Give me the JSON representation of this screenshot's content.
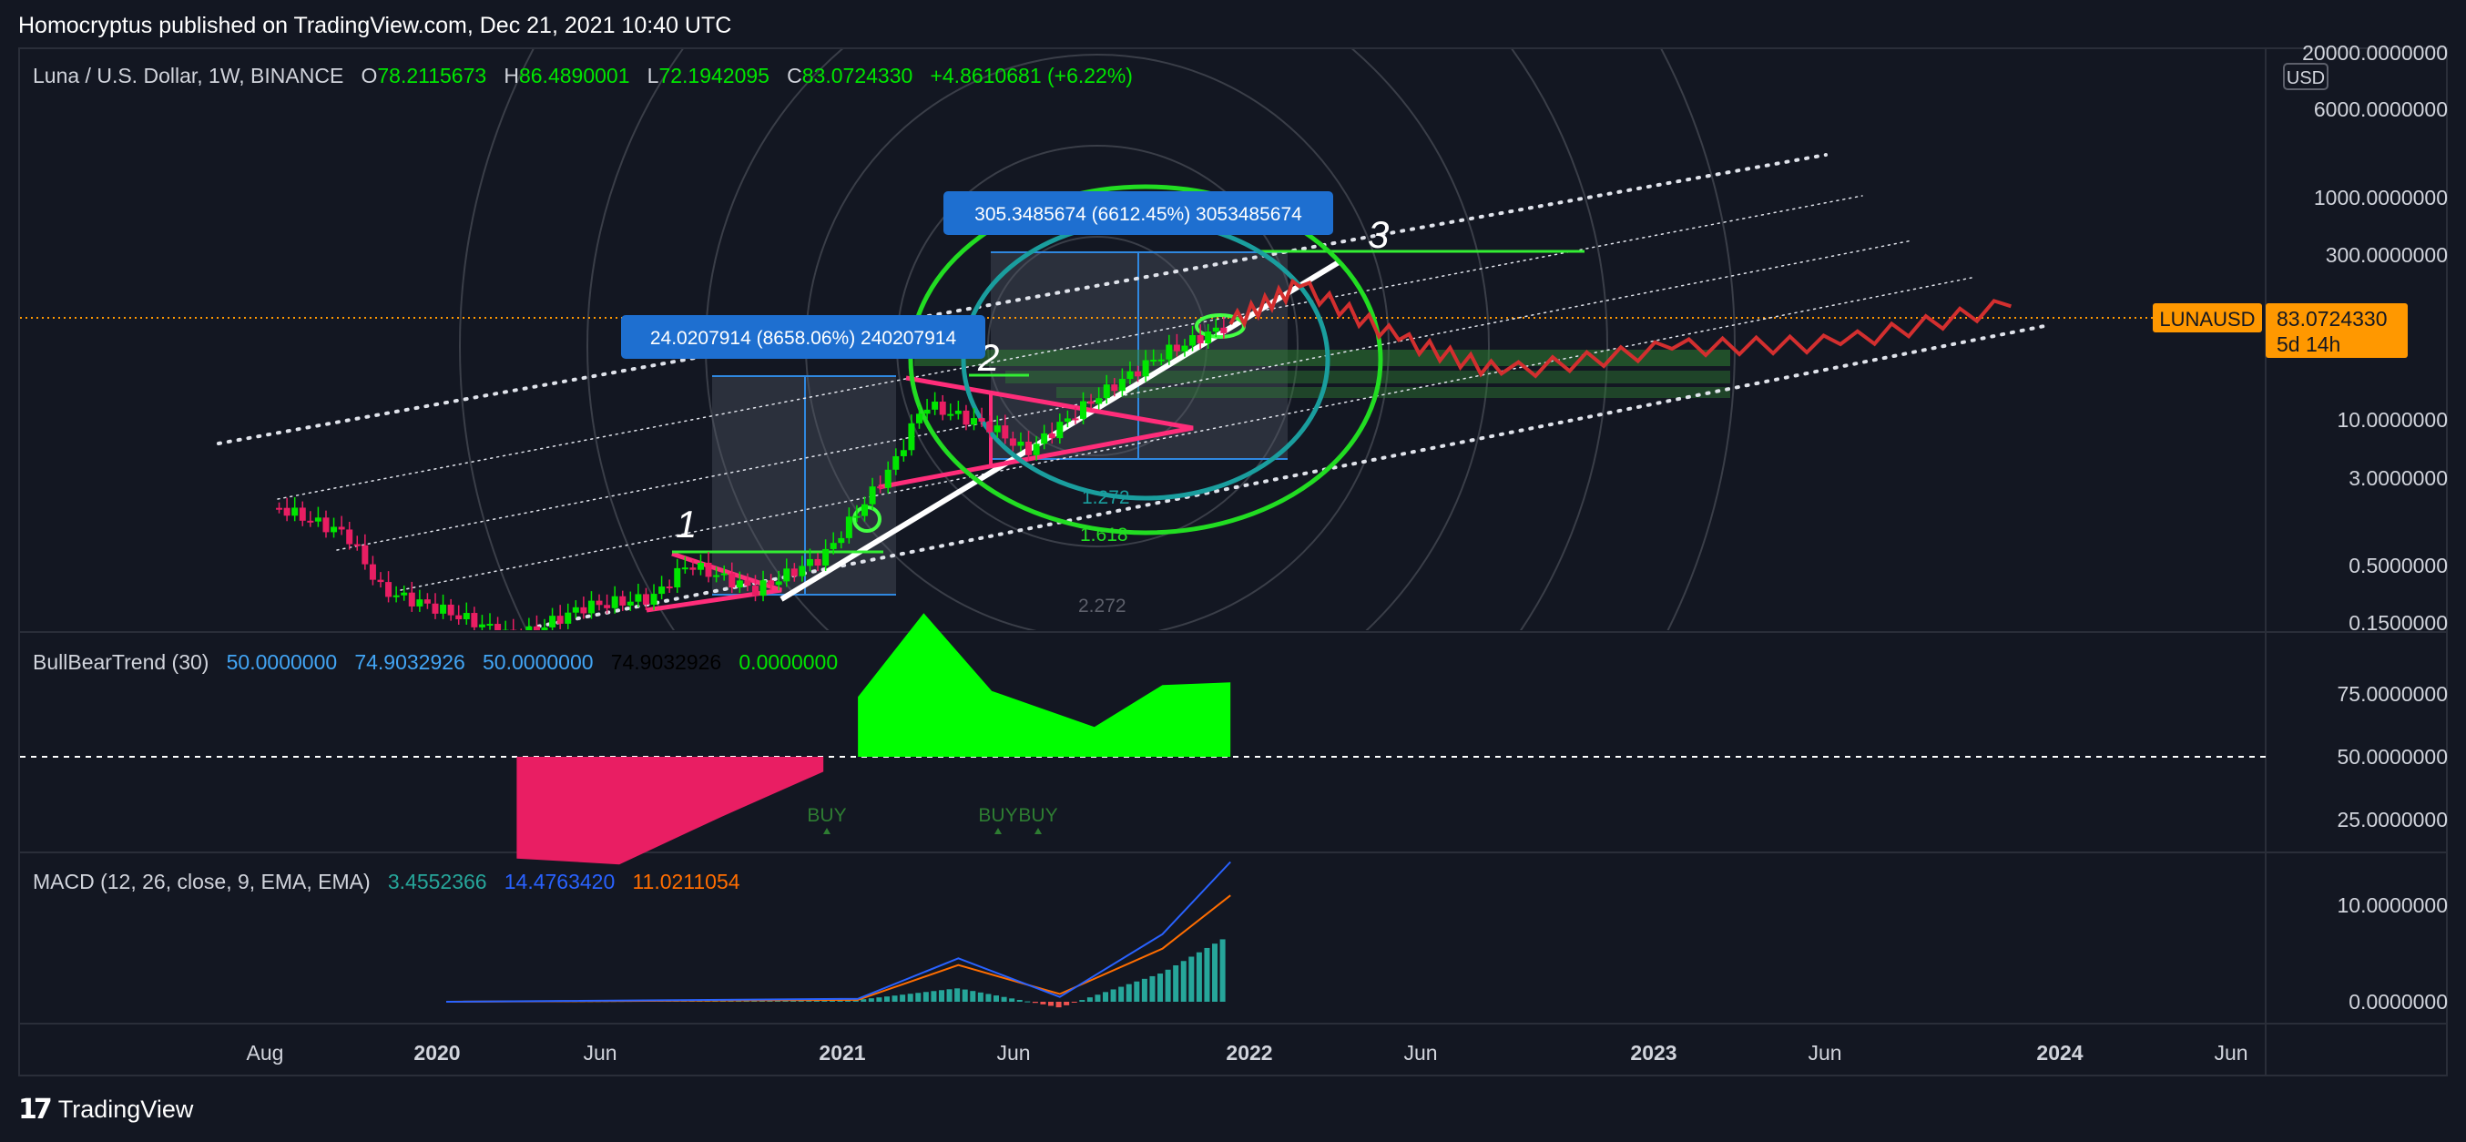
{
  "header": {
    "published": "Homocryptus published on TradingView.com, Dec 21, 2021 10:40 UTC"
  },
  "symbol": {
    "title": "Luna / U.S. Dollar, 1W, BINANCE",
    "open_label": "O",
    "open": "78.2115673",
    "high_label": "H",
    "high": "86.4890001",
    "low_label": "L",
    "low": "72.1942095",
    "close_label": "C",
    "close": "83.0724330",
    "change": "+4.8610681 (+6.22%)",
    "ticker": "LUNAUSD",
    "last_price": "83.0724330",
    "countdown": "5d 14h",
    "currency": "USD"
  },
  "price_axis": {
    "labels": [
      "20000.0000000",
      "6000.0000000",
      "1000.0000000",
      "300.0000000",
      "10.0000000",
      "3.0000000",
      "0.5000000",
      "0.1500000"
    ]
  },
  "time_axis": {
    "labels": [
      "Aug",
      "2020",
      "Jun",
      "2021",
      "Jun",
      "2022",
      "Jun",
      "2023",
      "Jun",
      "2024",
      "Jun"
    ]
  },
  "annotations": {
    "measure_big": "305.3485674 (6612.45%) 3053485674",
    "measure_small": "24.0207914 (8658.06%) 240207914",
    "fib_labels": [
      "1.272",
      "1.618",
      "2.272"
    ],
    "wave_labels": [
      "1",
      "2",
      "3"
    ]
  },
  "bullbear": {
    "title": "BullBearTrend (30)",
    "values": [
      "50.0000000",
      "74.9032926",
      "50.0000000",
      "74.9032926",
      "0.0000000"
    ],
    "axis_labels": [
      "75.0000000",
      "50.0000000",
      "25.0000000"
    ],
    "signals": [
      "BUY",
      "BUY",
      "BUY"
    ]
  },
  "macd": {
    "title": "MACD (12, 26, close, 9, EMA, EMA)",
    "values": [
      "3.4552366",
      "14.4763420",
      "11.0211054"
    ],
    "axis_labels": [
      "10.0000000",
      "0.0000000"
    ]
  },
  "footer": {
    "brand": "TradingView"
  },
  "colors": {
    "background": "#131722",
    "up": "#00e600",
    "down": "#e91e63",
    "projection": "#d32f2f",
    "circle": "#22dd22",
    "inner_circle": "#1a9e9e",
    "measure_box": "#1e6fd0",
    "price_tag": "#ff9800",
    "macd_line": "#2962ff",
    "signal_line": "#ff6d00",
    "bull_fill": "#00ff00",
    "bear_fill": "#e91e63"
  },
  "chart_data": [
    {
      "type": "candlestick",
      "title": "Luna / U.S. Dollar, 1W, BINANCE",
      "y_scale": "log",
      "ylim": [
        0.1,
        20000
      ],
      "x_ticks": [
        "Aug",
        "2020",
        "Jun",
        "2021",
        "Jun",
        "2022",
        "Jun",
        "2023",
        "Jun",
        "2024",
        "Jun"
      ],
      "price_path": [
        {
          "date": "2019-08",
          "price": 1.9
        },
        {
          "date": "2019-10",
          "price": 1.1
        },
        {
          "date": "2019-11",
          "price": 0.35
        },
        {
          "date": "2020-01",
          "price": 0.22
        },
        {
          "date": "2020-03",
          "price": 0.13
        },
        {
          "date": "2020-05",
          "price": 0.25
        },
        {
          "date": "2020-07",
          "price": 0.3
        },
        {
          "date": "2020-08",
          "price": 0.6
        },
        {
          "date": "2020-10",
          "price": 0.35
        },
        {
          "date": "2020-12",
          "price": 0.7
        },
        {
          "date": "2021-02",
          "price": 4.5
        },
        {
          "date": "2021-03",
          "price": 16
        },
        {
          "date": "2021-05",
          "price": 10
        },
        {
          "date": "2021-06",
          "price": 6
        },
        {
          "date": "2021-08",
          "price": 18
        },
        {
          "date": "2021-10",
          "price": 45
        },
        {
          "date": "2021-12",
          "price": 83.07
        }
      ],
      "projection": [
        {
          "date": "2022-02",
          "price": 180
        },
        {
          "date": "2022-05",
          "price": 60
        },
        {
          "date": "2022-08",
          "price": 30
        },
        {
          "date": "2023-01",
          "price": 50
        },
        {
          "date": "2023-06",
          "price": 55
        },
        {
          "date": "2023-11",
          "price": 120
        }
      ],
      "current_price": 83.072433
    },
    {
      "type": "area",
      "title": "BullBearTrend (30)",
      "ylim": [
        0,
        100
      ],
      "bear_dates": [
        "2020-03",
        "2020-06",
        "2020-09",
        "2020-12"
      ],
      "bear_values": [
        16,
        14,
        30,
        45
      ],
      "bull_dates": [
        "2021-01",
        "2021-03",
        "2021-05",
        "2021-08",
        "2021-10",
        "2021-12"
      ],
      "bull_values": [
        70,
        98,
        72,
        60,
        74,
        74.9
      ]
    },
    {
      "type": "line",
      "title": "MACD (12, 26, close, 9, EMA, EMA)",
      "series": [
        {
          "name": "MACD",
          "dates": [
            "2020-01",
            "2021-01",
            "2021-04",
            "2021-07",
            "2021-10",
            "2021-12"
          ],
          "values": [
            0,
            0.3,
            4.5,
            0.5,
            7,
            14.48
          ]
        },
        {
          "name": "Signal",
          "dates": [
            "2020-01",
            "2021-01",
            "2021-04",
            "2021-07",
            "2021-10",
            "2021-12"
          ],
          "values": [
            0,
            0.2,
            3.8,
            0.8,
            5.5,
            11.02
          ]
        }
      ]
    }
  ]
}
